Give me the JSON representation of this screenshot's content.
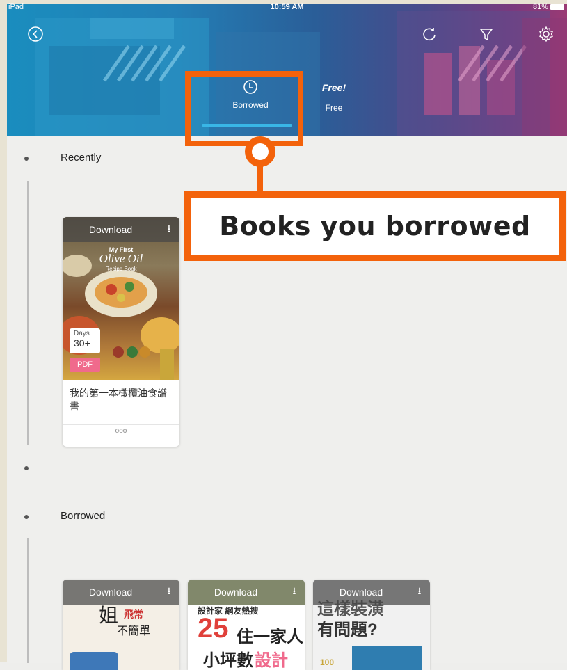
{
  "status_bar": {
    "carrier": "iPad",
    "time": "10:59 AM",
    "battery": "81%"
  },
  "toolbar": {
    "back_icon": "back-circle-icon",
    "refresh_icon": "refresh-icon",
    "filter_icon": "filter-icon",
    "settings_icon": "gear-icon"
  },
  "tabs": [
    {
      "label": "Borrowed",
      "icon": "clock-icon",
      "active": true
    },
    {
      "label": "Free",
      "badge": "Free!",
      "active": false
    }
  ],
  "sections": [
    {
      "title": "Recently",
      "books": [
        {
          "download_label": "Download",
          "cover_heading": "My First",
          "cover_title": "Olive Oil",
          "cover_subtitle": "Recipe Book",
          "days_label": "Days",
          "days_value": "30+",
          "format": "PDF",
          "title": "我的第一本橄欖油食譜書",
          "more": "ooo"
        }
      ]
    },
    {
      "title": "Borrowed",
      "books": [
        {
          "download_label": "Download",
          "cover_text_1": "姐",
          "cover_text_2": "飛常",
          "cover_text_3": "不簡單"
        },
        {
          "download_label": "Download",
          "cover_text_1": "設計家 網友熱搜",
          "cover_text_2": "25",
          "cover_text_3": "住一家人",
          "cover_text_4": "小坪數",
          "cover_text_5": "設計"
        },
        {
          "download_label": "Download",
          "cover_text_1": "這樣裝潢",
          "cover_text_2": "有問題?",
          "cover_text_3": "100"
        }
      ]
    }
  ],
  "callout": {
    "text": "Books you borrowed"
  },
  "colors": {
    "accent": "#f3620b",
    "tab_underline": "#39b6e6",
    "pdf_badge": "#f06a8c"
  }
}
